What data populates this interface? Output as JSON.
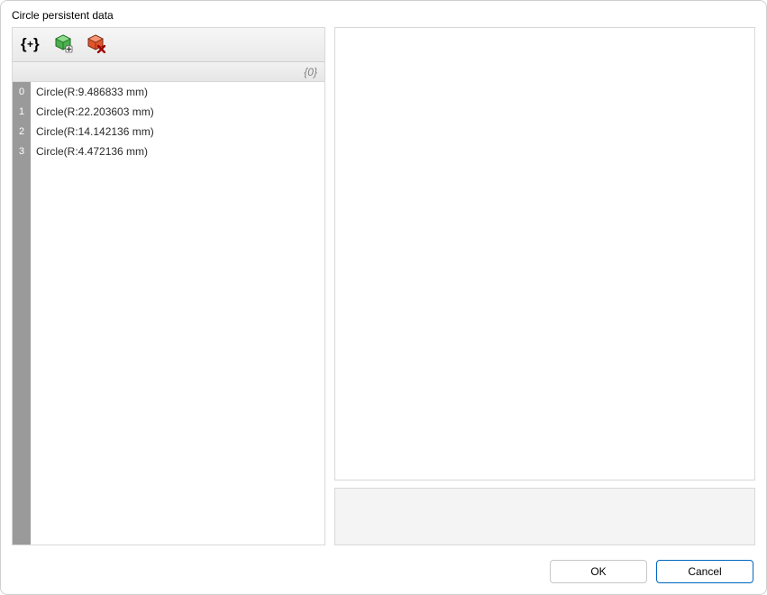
{
  "window": {
    "title": "Circle persistent data"
  },
  "toolbar": {
    "icons": {
      "add_branch": "add-branch-icon",
      "add_item": "add-item-icon",
      "remove_item": "remove-item-icon"
    }
  },
  "tree": {
    "header": {
      "group_label": "{0}"
    },
    "items": [
      {
        "index": "0",
        "label": "Circle(R:9.486833 mm)"
      },
      {
        "index": "1",
        "label": "Circle(R:22.203603 mm)"
      },
      {
        "index": "2",
        "label": "Circle(R:14.142136 mm)"
      },
      {
        "index": "3",
        "label": "Circle(R:4.472136 mm)"
      }
    ]
  },
  "buttons": {
    "ok": "OK",
    "cancel": "Cancel"
  }
}
